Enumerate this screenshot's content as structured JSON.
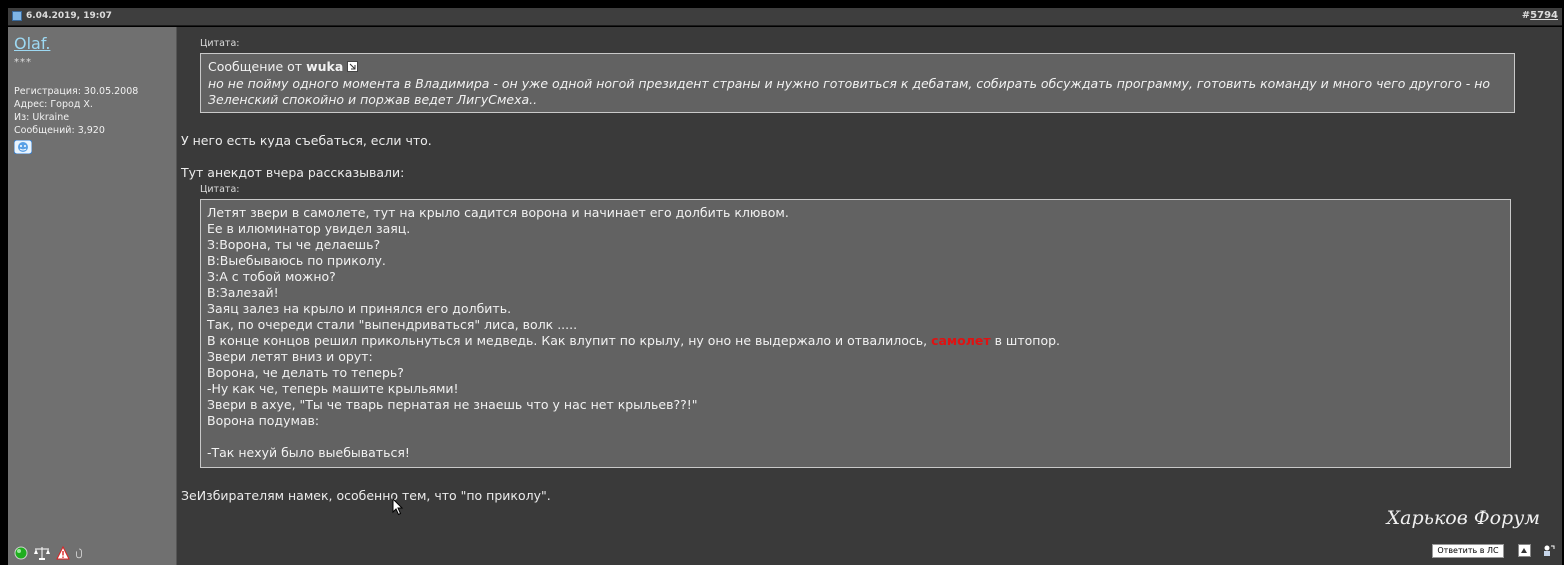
{
  "post": {
    "date": "6.04.2019, 19:07",
    "number_prefix": "#",
    "number": "5794"
  },
  "user": {
    "name": "Olaf.",
    "stars": "***",
    "info": [
      "Регистрация: 30.05.2008",
      "Адрес: Город Х.",
      "Из: Ukraine",
      "Сообщений: 3,920"
    ]
  },
  "quote_label": "Цитата:",
  "quote1": {
    "from_prefix": "Сообщение от",
    "author": "wuka",
    "text": "но не пойму одного момента в Владимира - он уже одной ногой президент страны и нужно готовиться к дебатам, собирать обсуждать программу, готовить команду и много чего другого - но Зеленский спокойно и поржав ведет ЛигуСмеха.."
  },
  "body1": "У него есть куда съебаться, если что.",
  "body2": "Тут анекдот вчера рассказывали:",
  "quote2": {
    "lines": [
      "Летят звери в самолете, тут на крыло садится ворона и начинает его долбить клювом.",
      "Ее в илюминатор увидел заяц.",
      "З:Ворона, ты че делаешь?",
      "В:Выебываюсь по приколу.",
      "З:А с тобой можно?",
      "В:Залезай!",
      "Заяц залез на крыло и принялся его долбить.",
      "Так, по очереди стали \"выпендриваться\" лиса, волк .....",
      "",
      "Звери летят вниз и орут:",
      "Ворона, че делать то теперь?",
      "-Ну как че, теперь машите крыльями!",
      "Звери в ахуе, \"Ты че тварь пернатая не знаешь что у нас нет крыльев??!\"",
      "Ворона подумав:",
      "",
      "-Так нехуй было выебываться!"
    ],
    "line9_before": "В конце концов решил прикольнуться и медведь. Как влупит по крылу, ну оно не выдержало и отвалилось,",
    "line9_red": "самолет",
    "line9_after": "в штопор."
  },
  "body3": "ЗеИзбирателям намек, особенно тем, что \"по приколу\".",
  "signature": "Харьков Форум",
  "reply_label": "Ответить в ЛС",
  "colors": {
    "username": "#9dd9f3",
    "highlight": "#e01212",
    "quote_bg": "#626262",
    "content_bg": "#3a3a3a",
    "sidebar_bg": "#707070"
  }
}
